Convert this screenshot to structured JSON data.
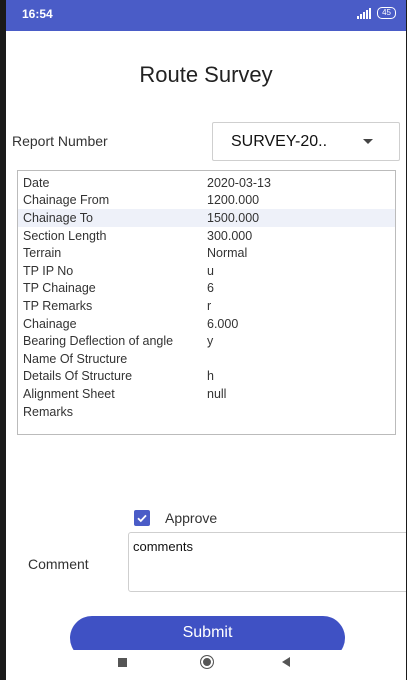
{
  "status": {
    "time": "16:54",
    "battery": "45"
  },
  "page": {
    "title": "Route Survey"
  },
  "report": {
    "label": "Report Number",
    "selected": "SURVEY-20.."
  },
  "details": [
    {
      "key": "Date",
      "value": "2020-03-13"
    },
    {
      "key": "Chainage From",
      "value": "1200.000"
    },
    {
      "key": "Chainage To",
      "value": "1500.000"
    },
    {
      "key": "Section Length",
      "value": "300.000"
    },
    {
      "key": "Terrain",
      "value": "Normal"
    },
    {
      "key": "TP IP No",
      "value": "u"
    },
    {
      "key": "TP Chainage",
      "value": "6"
    },
    {
      "key": "TP Remarks",
      "value": "r"
    },
    {
      "key": "Chainage",
      "value": "6.000"
    },
    {
      "key": "Bearing Deflection of angle",
      "value": "y"
    },
    {
      "key": "Name Of Structure",
      "value": ""
    },
    {
      "key": "Details Of Structure",
      "value": "h"
    },
    {
      "key": "Alignment Sheet",
      "value": "null"
    },
    {
      "key": "Remarks",
      "value": ""
    }
  ],
  "approve": {
    "label": "Approve",
    "checked": true
  },
  "comment": {
    "label": "Comment",
    "value": "comments"
  },
  "submit": {
    "label": "Submit"
  },
  "colors": {
    "primary": "#3f51c4",
    "status_bar": "#4a5cc7",
    "row_highlight": "#eef1f9"
  },
  "nav": {
    "icons": [
      "recent-apps-icon",
      "home-icon",
      "back-icon"
    ]
  }
}
